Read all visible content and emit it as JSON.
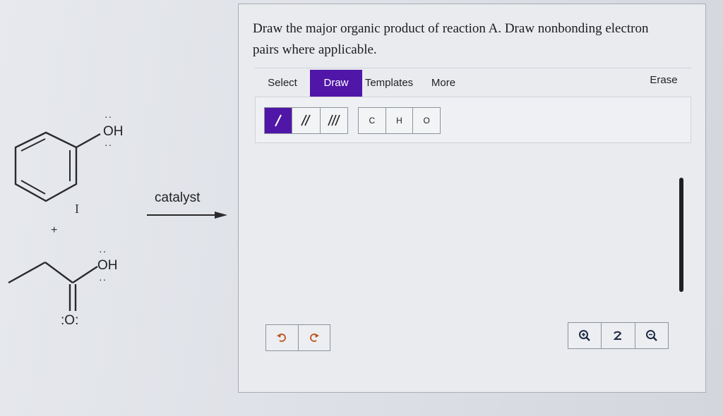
{
  "reaction": {
    "reactant1_group": "OH",
    "reactant2_group": "OH",
    "carbonyl_oxygen": "O",
    "lone_pair_marks": ":",
    "roman_numeral": "I",
    "plus_sign": "+",
    "catalyst_label": "catalyst"
  },
  "question": {
    "line1": "Draw the major organic product of reaction A. Draw nonbonding electron",
    "line2": "pairs where applicable."
  },
  "tabs": [
    {
      "label": "Select",
      "active": false
    },
    {
      "label": "Draw",
      "active": true
    },
    {
      "label": "Templates",
      "active": false
    },
    {
      "label": "More",
      "active": false
    }
  ],
  "erase_label": "Erase",
  "bond_tools": [
    {
      "icon": "single-bond-icon",
      "active": true
    },
    {
      "icon": "double-bond-icon",
      "active": false
    },
    {
      "icon": "triple-bond-icon",
      "active": false
    }
  ],
  "atom_tools": [
    "C",
    "H",
    "O"
  ],
  "controls": {
    "undo_icon": "undo-icon",
    "redo_icon": "redo-icon",
    "zoom_in_icon": "zoom-in-icon",
    "reset_icon": "reset-zoom-icon",
    "zoom_out_icon": "zoom-out-icon"
  },
  "colors": {
    "accent": "#5016a8",
    "icon_orange": "#c0521e"
  }
}
